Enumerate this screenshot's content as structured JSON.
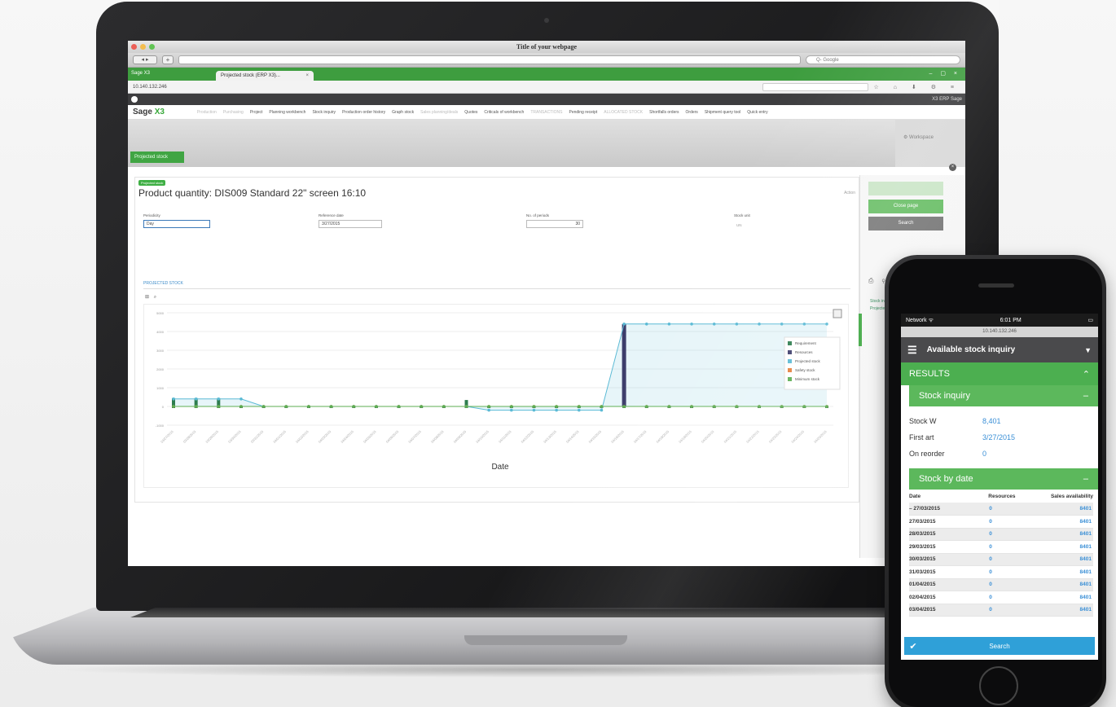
{
  "browser": {
    "window_title": "Title of your webpage",
    "search_placeholder": "Q- Google",
    "nav_label": "◂ ▸",
    "tab_label": "Projected stock (ERP X3)...",
    "tab_close": "×",
    "side_tab_label": "Sage X3",
    "addr_text": "10.140.132.246",
    "addr_icons": "☆ ⌂ ⬇ ⚙ ≡"
  },
  "app": {
    "brand_prefix": "Sage",
    "brand_suffix": "X3",
    "menu": [
      {
        "label": "Production",
        "dim": true
      },
      {
        "label": "Purchasing",
        "dim": true
      },
      {
        "label": "Project"
      },
      {
        "label": "Planning workbench"
      },
      {
        "label": "Stock inquiry"
      },
      {
        "label": "Production order history"
      },
      {
        "label": "Graph stock"
      },
      {
        "label": "Sales planning/deals",
        "dim": true
      },
      {
        "label": "Quotes"
      },
      {
        "label": "Criticals of workbench"
      },
      {
        "label": "TRANSACTIONS",
        "dim": true
      },
      {
        "label": "Pending receipt"
      },
      {
        "label": "ALLOCATED STOCK",
        "dim": true
      },
      {
        "label": "Shortfalls orders"
      },
      {
        "label": "Orders"
      },
      {
        "label": "Shipment query tool"
      },
      {
        "label": "Quick entry"
      }
    ],
    "ribbon_button": "Projected stock",
    "ribbon_right_label": "Workspace",
    "appbar_right": "X3 ERP Sage"
  },
  "page": {
    "badge": "Projected stock",
    "title": "Product quantity: DIS009 Standard 22\" screen 16:10",
    "actions_menu": "Action",
    "fields": {
      "periodicity_label": "Periodicity",
      "periodicity_value": "Day",
      "ref_date_label": "Reference date",
      "ref_date_value": "3/27/2015",
      "num_periods_label": "No. of periods",
      "num_periods_value": "30",
      "stock_unit_label": "Stock unit",
      "stock_unit_value": "UN"
    },
    "section_title": "PROJECTED STOCK",
    "chart_tools": "⊞ ⌕"
  },
  "side_panel": {
    "buttons": [
      {
        "label": "",
        "color": "#cbe6c8"
      },
      {
        "label": "Close page",
        "color": "#6bbf68"
      },
      {
        "label": "Search",
        "color": "#7a7a7a"
      }
    ],
    "icons": "⎙ ⚲ ✉",
    "links": [
      "Stock inquiry",
      "Projected stock"
    ]
  },
  "chart_data": {
    "type": "line",
    "xlabel": "Date",
    "ylabel": "",
    "ylim": [
      -1000,
      5000
    ],
    "yticks": [
      -1000,
      0,
      1000,
      2000,
      3000,
      4000,
      5000
    ],
    "x": [
      "03/27/2015",
      "03/28/2015",
      "03/29/2015",
      "03/30/2015",
      "03/31/2015",
      "04/01/2015",
      "04/02/2015",
      "04/03/2015",
      "04/04/2015",
      "04/05/2015",
      "04/06/2015",
      "04/07/2015",
      "04/08/2015",
      "04/09/2015",
      "04/10/2015",
      "04/11/2015",
      "04/12/2015",
      "04/13/2015",
      "04/14/2015",
      "04/15/2015",
      "04/16/2015",
      "04/17/2015",
      "04/18/2015",
      "04/19/2015",
      "04/20/2015",
      "04/21/2015",
      "04/22/2015",
      "04/23/2015",
      "04/24/2015",
      "04/25/2015"
    ],
    "series": [
      {
        "name": "Requirement",
        "color": "#2e7d4f",
        "values": [
          400,
          400,
          400,
          0,
          0,
          0,
          0,
          0,
          0,
          0,
          0,
          0,
          0,
          300,
          0,
          0,
          0,
          0,
          0,
          0,
          0,
          0,
          0,
          0,
          0,
          0,
          0,
          0,
          0,
          0
        ]
      },
      {
        "name": "Resources",
        "color": "#3d3d6b",
        "values": [
          0,
          0,
          0,
          0,
          0,
          0,
          0,
          0,
          0,
          0,
          0,
          0,
          0,
          0,
          0,
          0,
          0,
          0,
          0,
          0,
          4400,
          0,
          0,
          0,
          0,
          0,
          0,
          0,
          0,
          0
        ]
      },
      {
        "name": "Projected stock",
        "color": "#5bbad5",
        "values": [
          400,
          400,
          400,
          400,
          0,
          0,
          0,
          0,
          0,
          0,
          0,
          0,
          0,
          0,
          -200,
          -200,
          -200,
          -200,
          -200,
          -200,
          4400,
          4400,
          4400,
          4400,
          4400,
          4400,
          4400,
          4400,
          4400,
          4400
        ]
      },
      {
        "name": "Safety stock",
        "color": "#e57f3b",
        "values": [
          0,
          0,
          0,
          0,
          0,
          0,
          0,
          0,
          0,
          0,
          0,
          0,
          0,
          0,
          0,
          0,
          0,
          0,
          0,
          0,
          0,
          0,
          0,
          0,
          0,
          0,
          0,
          0,
          0,
          0
        ]
      },
      {
        "name": "Minimum stock",
        "color": "#5cae52",
        "values": [
          0,
          0,
          0,
          0,
          0,
          0,
          0,
          0,
          0,
          0,
          0,
          0,
          0,
          0,
          0,
          0,
          0,
          0,
          0,
          0,
          0,
          0,
          0,
          0,
          0,
          0,
          0,
          0,
          0,
          0
        ]
      }
    ],
    "legend_position": "right",
    "grid": true
  },
  "phone": {
    "status_network": "Network ᯤ",
    "status_time": "6:01 PM",
    "status_battery": "▭",
    "url": "10.140.132.246",
    "header_title": "Available stock inquiry",
    "results_label": "RESULTS",
    "stock_inquiry_label": "Stock inquiry",
    "kv": [
      {
        "k": "Stock W",
        "v": "8,401"
      },
      {
        "k": "First art",
        "v": "3/27/2015"
      },
      {
        "k": "On reorder",
        "v": "0"
      }
    ],
    "stock_by_date_label": "Stock by date",
    "table_headers": [
      "Date",
      "Resources",
      "Sales availability"
    ],
    "rows": [
      {
        "date": "– 27/03/2015",
        "res": "0",
        "avail": "8401"
      },
      {
        "date": "27/03/2015",
        "res": "0",
        "avail": "8401"
      },
      {
        "date": "28/03/2015",
        "res": "0",
        "avail": "8401"
      },
      {
        "date": "29/03/2015",
        "res": "0",
        "avail": "8401"
      },
      {
        "date": "30/03/2015",
        "res": "0",
        "avail": "8401"
      },
      {
        "date": "31/03/2015",
        "res": "0",
        "avail": "8401"
      },
      {
        "date": "01/04/2015",
        "res": "0",
        "avail": "8401"
      },
      {
        "date": "02/04/2015",
        "res": "0",
        "avail": "8401"
      },
      {
        "date": "03/04/2015",
        "res": "0",
        "avail": "8401"
      }
    ],
    "search_label": "Search",
    "search_icon": "✔"
  }
}
